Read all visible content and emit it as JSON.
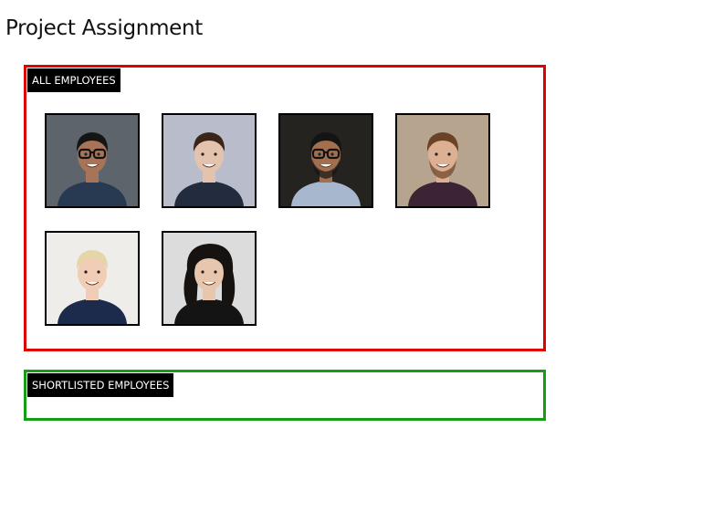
{
  "page": {
    "title": "Project Assignment"
  },
  "all_employees": {
    "label": "ALL EMPLOYEES",
    "border_color": "#e00000",
    "employees": [
      {
        "icon": "employee-photo-icon",
        "bg": "#5e646c",
        "skin": "#a87458",
        "hair": "#151515",
        "shirt": "#273a52",
        "glasses": true,
        "beard": false,
        "long_hair": false
      },
      {
        "icon": "employee-photo-icon",
        "bg": "#b9bccb",
        "skin": "#e4c3ae",
        "hair": "#3a2619",
        "shirt": "#232b3e",
        "glasses": false,
        "beard": false,
        "long_hair": false
      },
      {
        "icon": "employee-photo-icon",
        "bg": "#252320",
        "skin": "#a2704e",
        "hair": "#141414",
        "shirt": "#a7b7cd",
        "glasses": true,
        "beard": true,
        "long_hair": false
      },
      {
        "icon": "employee-photo-icon",
        "bg": "#b7a48f",
        "skin": "#ddb093",
        "hair": "#6a4226",
        "shirt": "#3d2434",
        "glasses": false,
        "beard": true,
        "long_hair": false
      },
      {
        "icon": "employee-photo-icon",
        "bg": "#efede9",
        "skin": "#f0cdb4",
        "hair": "#e4d6a6",
        "shirt": "#1c2b4c",
        "glasses": false,
        "beard": false,
        "long_hair": false
      },
      {
        "icon": "employee-photo-icon",
        "bg": "#dcdcdc",
        "skin": "#e7c6ad",
        "hair": "#161210",
        "shirt": "#141414",
        "glasses": false,
        "beard": false,
        "long_hair": true
      }
    ]
  },
  "shortlisted_employees": {
    "label": "SHORTLISTED EMPLOYEES",
    "border_color": "#12a012",
    "employees": []
  }
}
